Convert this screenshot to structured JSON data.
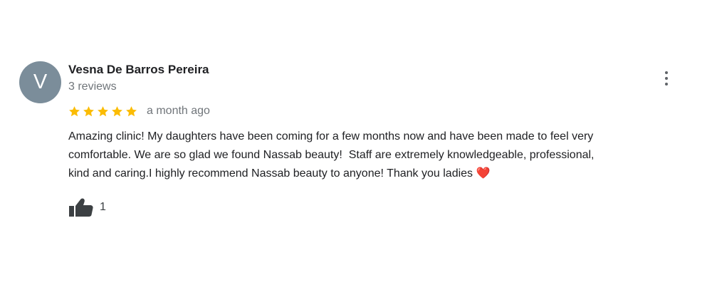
{
  "review": {
    "author": {
      "initial": "V",
      "name": "Vesna De Barros Pereira",
      "review_count": "3 reviews",
      "avatar_color": "#7b8d9a"
    },
    "rating": 5,
    "max_rating": 5,
    "time": "a month ago",
    "text": "Amazing clinic! My daughters have been coming for a few months now and have been made to feel very\ncomfortable. We are so glad we found Nassab beauty!  Staff are extremely knowledgeable, professional,\nkind and caring.I highly recommend Nassab beauty to anyone! Thank you ladies ❤️",
    "likes": "1",
    "menu_icon": "more-vert-icon",
    "like_icon": "thumbs-up-icon",
    "star_color": "#fbbc04"
  }
}
